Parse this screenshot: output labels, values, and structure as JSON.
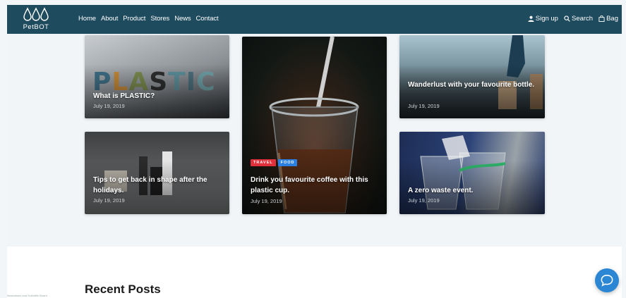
{
  "brand": {
    "name": "PetBOT"
  },
  "nav": {
    "menu": [
      "Home",
      "About",
      "Product",
      "Stores",
      "News",
      "Contact"
    ],
    "actions": {
      "signup": "Sign up",
      "search": "Search",
      "bag": "Bag"
    }
  },
  "featured": [
    {
      "title": "What is PLASTIC?",
      "date": "July 19, 2019",
      "image_text": "PLASTIC"
    },
    {
      "title": "Drink you favourite coffee with this plastic cup.",
      "date": "July 19, 2019",
      "tags": [
        "TRAVEL",
        "FOOD"
      ]
    },
    {
      "title": "Wanderlust with your favourite bottle.",
      "date": "July 19, 2019"
    },
    {
      "title": "Tips to get back in shape after the holidays.",
      "date": "July 19, 2019"
    },
    {
      "title": "A zero waste event.",
      "date": "July 19, 2019"
    }
  ],
  "recent": {
    "title": "Recent Posts"
  },
  "footer": {
    "credit": "Illustrations and Scientific Board"
  },
  "colors": {
    "navbar": "#1f4b5e",
    "tag_travel": "#e0303c",
    "tag_food": "#2b7fe0",
    "chat": "#2b86d3"
  },
  "icons": [
    "droplet-icon",
    "user-icon",
    "search-icon",
    "bag-icon",
    "chat-icon"
  ]
}
